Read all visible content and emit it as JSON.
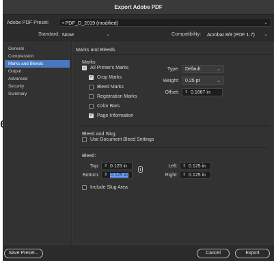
{
  "window": {
    "title": "Export Adobe PDF"
  },
  "outside": {
    "glyph": "e"
  },
  "preset": {
    "label": "Adobe PDF Preset:",
    "value": "• PDF_D_2019 (modified)"
  },
  "standard": {
    "label": "Standard:",
    "value": "None"
  },
  "compatibility": {
    "label": "Compatibility:",
    "value": "Acrobat 8/9 (PDF 1.7)"
  },
  "sidebar": {
    "items": [
      {
        "label": "General"
      },
      {
        "label": "Compression"
      },
      {
        "label": "Marks and Bleeds"
      },
      {
        "label": "Output"
      },
      {
        "label": "Advanced"
      },
      {
        "label": "Security"
      },
      {
        "label": "Summary"
      }
    ]
  },
  "panel": {
    "title": "Marks and Bleeds",
    "marks": {
      "title": "Marks",
      "all_printers": "All Printer's Marks",
      "crop": "Crop Marks",
      "bleed": "Bleed Marks",
      "registration": "Registration Marks",
      "color_bars": "Color Bars",
      "page_info": "Page Information",
      "type_label": "Type:",
      "type_value": "Default",
      "weight_label": "Weight:",
      "weight_value": "0.25 pt",
      "offset_label": "Offset:",
      "offset_value": "0.1667 in"
    },
    "bleed": {
      "title": "Bleed and Slug",
      "use_doc": "Use Document Bleed Settings",
      "bleed_label": "Bleed:",
      "top_label": "Top:",
      "top_value": "0.125 in",
      "bottom_label": "Bottom:",
      "bottom_value": "0.125 in",
      "left_label": "Left:",
      "left_value": "0.125 in",
      "right_label": "Right:",
      "right_value": "0.125 in",
      "slug": "Include Slug Area"
    }
  },
  "buttons": {
    "save_preset": "Save Preset...",
    "cancel": "Cancel",
    "export": "Export"
  },
  "colors": {
    "accent": "#4a78c0",
    "highlight": "#6aa3ff",
    "background": "#2b2b2b"
  }
}
